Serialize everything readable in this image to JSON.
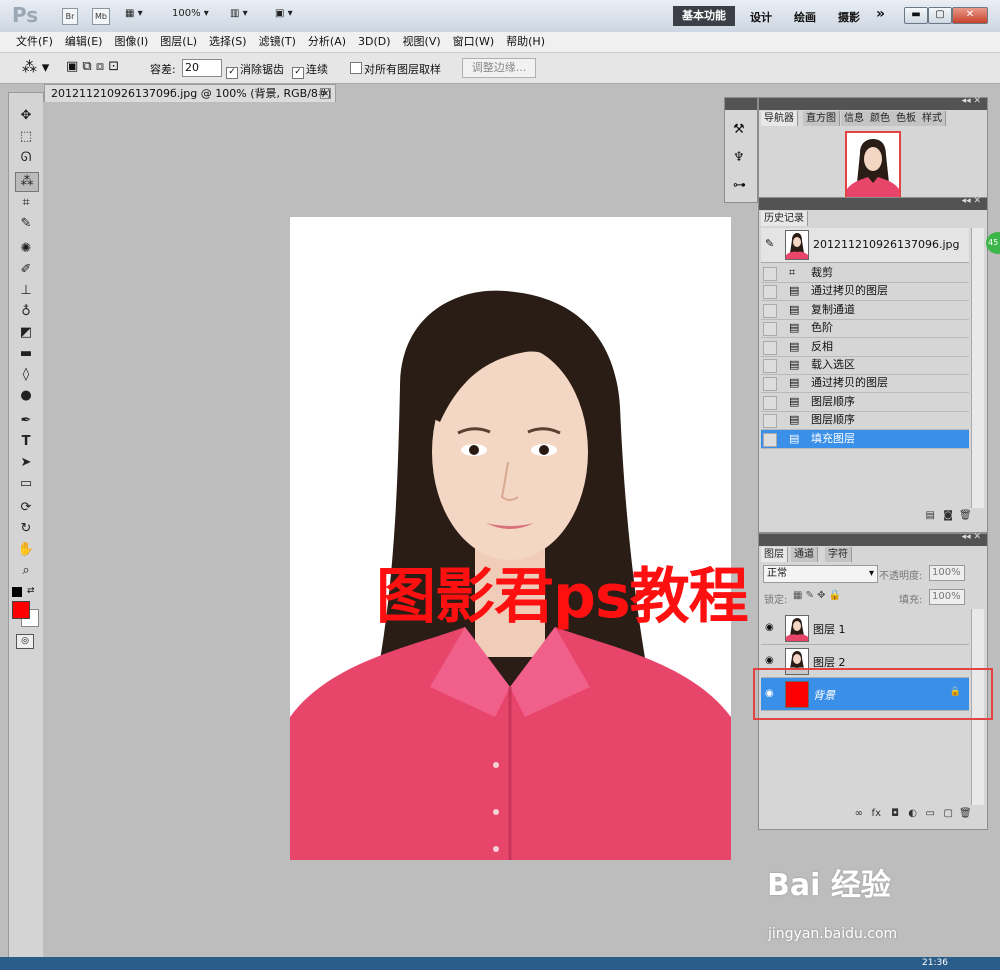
{
  "app": {
    "logo": "Ps",
    "bridge_label": "Br",
    "minibridge_label": "Mb",
    "zoom": "100%",
    "workspaces": [
      "基本功能",
      "设计",
      "绘画",
      "摄影"
    ],
    "more": "»"
  },
  "menu": [
    "文件(F)",
    "编辑(E)",
    "图像(I)",
    "图层(L)",
    "选择(S)",
    "滤镜(T)",
    "分析(A)",
    "3D(D)",
    "视图(V)",
    "窗口(W)",
    "帮助(H)"
  ],
  "options": {
    "tolerance_label": "容差:",
    "tolerance_value": "20",
    "antialias_label": "消除锯齿",
    "contiguous_label": "连续",
    "sample_all_label": "对所有图层取样",
    "refine_edge_label": "调整边缘..."
  },
  "document": {
    "tab_title": "20121121092613709б.jpg @ 100% (背景, RGB/8#) *",
    "watermark": "图影君ps教程"
  },
  "navigator": {
    "tabs": [
      "导航器",
      "直方图",
      "信息",
      "颜色",
      "色板",
      "样式"
    ]
  },
  "history": {
    "tab": "历史记录",
    "snapshot": "201211210926137096.jpg",
    "items": [
      "裁剪",
      "通过拷贝的图层",
      "复制通道",
      "色阶",
      "反相",
      "载入选区",
      "通过拷贝的图层",
      "图层顺序",
      "图层顺序",
      "填充图层"
    ],
    "selected_index": 9
  },
  "layers": {
    "tabs": [
      "图层",
      "通道",
      "字符"
    ],
    "blend_mode": "正常",
    "opacity_label": "不透明度:",
    "opacity_value": "100%",
    "lock_label": "锁定:",
    "fill_label": "填充:",
    "fill_value": "100%",
    "items": [
      {
        "name": "图层 1"
      },
      {
        "name": "图层 2"
      },
      {
        "name": "背景"
      }
    ],
    "selected_index": 2,
    "highlight_color": "#e24444"
  },
  "badge": "45",
  "baidu": {
    "logo": "Bai 经验",
    "url": "jingyan.baidu.com"
  },
  "clock": "21:36",
  "colors": {
    "foreground": "#ff0000",
    "background": "#ffffff",
    "selection": "#3a8fe8",
    "shirt": "#e8456a"
  }
}
